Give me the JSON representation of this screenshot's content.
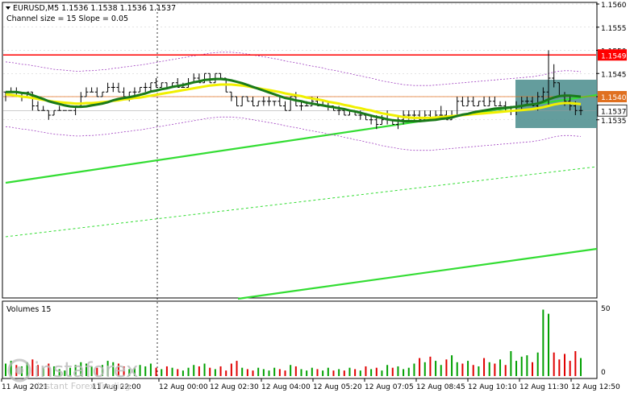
{
  "header": {
    "symbol_line": "EURUSD,M5  1.1536 1.1538 1.1536 1.1537",
    "indicator_line": "Channel size = 15 Slope = 0.05"
  },
  "volume_panel": {
    "title": "Volumes 15",
    "axis_labels": [
      "50",
      "0"
    ]
  },
  "watermark": {
    "brand": "instaforex",
    "tagline": "Instant Forex Trading"
  },
  "colors": {
    "bull_volume": "#00a000",
    "bear_volume": "#e00000",
    "ma_fast": "#1a7a1a",
    "ma_slow": "#f0f000",
    "channel": "#33dd33",
    "resistance": "#ff0000",
    "highlight_box": "#4f8f8f"
  },
  "chart_data": {
    "type": "candlestick",
    "symbol": "EURUSD",
    "timeframe": "M5",
    "ylim": [
      1.153,
      1.156
    ],
    "price_ticks": [
      1.156,
      1.1555,
      1.155,
      1.1545,
      1.154,
      1.1535
    ],
    "price_tick_labels": [
      "1.1560",
      "1.1555",
      "1.1550",
      "1.1545",
      "1.1540",
      "1.1535"
    ],
    "time_labels": [
      "11 Aug 2021",
      "11 Aug 22:00",
      "12 Aug 00:00",
      "12 Aug 02:30",
      "12 Aug 04:00",
      "12 Aug 05:20",
      "12 Aug 07:05",
      "12 Aug 08:45",
      "12 Aug 10:10",
      "12 Aug 11:30",
      "12 Aug 12:50"
    ],
    "levels": [
      {
        "price": 1.1549,
        "label": "1.1549",
        "style": "resistance"
      },
      {
        "price": 1.154,
        "label": "1.1540",
        "style": "support"
      }
    ],
    "current_price": {
      "price": 1.1537,
      "label": "1.1537"
    },
    "candles": [
      [
        1.1541,
        1.1541,
        1.1539,
        1.1541
      ],
      [
        1.1541,
        1.1542,
        1.1541,
        1.1541
      ],
      [
        1.1541,
        1.1542,
        1.154,
        1.154
      ],
      [
        1.154,
        1.1541,
        1.1539,
        1.154
      ],
      [
        1.154,
        1.1541,
        1.154,
        1.1541
      ],
      [
        1.1541,
        1.1541,
        1.1537,
        1.1538
      ],
      [
        1.1538,
        1.1539,
        1.1537,
        1.1537
      ],
      [
        1.1537,
        1.1538,
        1.1537,
        1.1537
      ],
      [
        1.1537,
        1.1537,
        1.1535,
        1.1536
      ],
      [
        1.1536,
        1.1537,
        1.1536,
        1.1537
      ],
      [
        1.1537,
        1.1538,
        1.1537,
        1.1537
      ],
      [
        1.1537,
        1.1537,
        1.1537,
        1.1537
      ],
      [
        1.1537,
        1.1537,
        1.1537,
        1.1537
      ],
      [
        1.1537,
        1.1538,
        1.1536,
        1.1538
      ],
      [
        1.1538,
        1.1541,
        1.1538,
        1.154
      ],
      [
        1.154,
        1.1542,
        1.154,
        1.1541
      ],
      [
        1.1541,
        1.1542,
        1.1541,
        1.1541
      ],
      [
        1.1541,
        1.1542,
        1.154,
        1.154
      ],
      [
        1.154,
        1.1541,
        1.154,
        1.1541
      ],
      [
        1.1541,
        1.1543,
        1.1541,
        1.1542
      ],
      [
        1.1542,
        1.1543,
        1.1541,
        1.1542
      ],
      [
        1.1542,
        1.1543,
        1.1541,
        1.1541
      ],
      [
        1.1541,
        1.1542,
        1.154,
        1.154
      ],
      [
        1.154,
        1.1541,
        1.1539,
        1.1541
      ],
      [
        1.1541,
        1.1542,
        1.154,
        1.1541
      ],
      [
        1.1541,
        1.1542,
        1.1541,
        1.1542
      ],
      [
        1.1542,
        1.1543,
        1.1541,
        1.1542
      ],
      [
        1.1542,
        1.1543,
        1.1541,
        1.1543
      ],
      [
        1.1543,
        1.1544,
        1.1542,
        1.1542
      ],
      [
        1.1542,
        1.1543,
        1.1542,
        1.1543
      ],
      [
        1.1543,
        1.1543,
        1.1542,
        1.1542
      ],
      [
        1.1542,
        1.1543,
        1.1542,
        1.1543
      ],
      [
        1.1543,
        1.1544,
        1.1542,
        1.1542
      ],
      [
        1.1542,
        1.1543,
        1.1542,
        1.1542
      ],
      [
        1.1542,
        1.1544,
        1.1542,
        1.1543
      ],
      [
        1.1543,
        1.1545,
        1.1543,
        1.1544
      ],
      [
        1.1544,
        1.1545,
        1.1543,
        1.1543
      ],
      [
        1.1543,
        1.1545,
        1.1543,
        1.1545
      ],
      [
        1.1545,
        1.1545,
        1.1543,
        1.1543
      ],
      [
        1.1543,
        1.1545,
        1.1543,
        1.1545
      ],
      [
        1.1545,
        1.1545,
        1.1544,
        1.1544
      ],
      [
        1.1544,
        1.1544,
        1.1541,
        1.1541
      ],
      [
        1.1541,
        1.1541,
        1.1539,
        1.154
      ],
      [
        1.154,
        1.154,
        1.1538,
        1.1538
      ],
      [
        1.1538,
        1.154,
        1.1538,
        1.154
      ],
      [
        1.154,
        1.154,
        1.1539,
        1.1539
      ],
      [
        1.1539,
        1.154,
        1.1538,
        1.1538
      ],
      [
        1.1538,
        1.1539,
        1.1538,
        1.1539
      ],
      [
        1.1539,
        1.154,
        1.1538,
        1.1539
      ],
      [
        1.1539,
        1.154,
        1.1538,
        1.1539
      ],
      [
        1.1539,
        1.1539,
        1.1538,
        1.1539
      ],
      [
        1.1539,
        1.154,
        1.1538,
        1.1538
      ],
      [
        1.1538,
        1.1539,
        1.1537,
        1.1537
      ],
      [
        1.1537,
        1.154,
        1.1537,
        1.154
      ],
      [
        1.154,
        1.1541,
        1.1538,
        1.1538
      ],
      [
        1.1538,
        1.1539,
        1.1537,
        1.1538
      ],
      [
        1.1538,
        1.1539,
        1.1538,
        1.1538
      ],
      [
        1.1538,
        1.154,
        1.1538,
        1.1539
      ],
      [
        1.1539,
        1.154,
        1.1538,
        1.1538
      ],
      [
        1.1538,
        1.1539,
        1.1538,
        1.1538
      ],
      [
        1.1538,
        1.1539,
        1.1537,
        1.1538
      ],
      [
        1.1538,
        1.1538,
        1.1537,
        1.1537
      ],
      [
        1.1537,
        1.1538,
        1.1536,
        1.1537
      ],
      [
        1.1537,
        1.1537,
        1.1536,
        1.1536
      ],
      [
        1.1536,
        1.1537,
        1.1536,
        1.1537
      ],
      [
        1.1537,
        1.1537,
        1.1536,
        1.1536
      ],
      [
        1.1536,
        1.1537,
        1.1535,
        1.1536
      ],
      [
        1.1536,
        1.1536,
        1.1535,
        1.1535
      ],
      [
        1.1535,
        1.1536,
        1.1534,
        1.1535
      ],
      [
        1.1535,
        1.1536,
        1.1533,
        1.1534
      ],
      [
        1.1534,
        1.1536,
        1.1534,
        1.1535
      ],
      [
        1.1535,
        1.1537,
        1.1534,
        1.1535
      ],
      [
        1.1535,
        1.1535,
        1.1534,
        1.1534
      ],
      [
        1.1534,
        1.1536,
        1.1533,
        1.1535
      ],
      [
        1.1535,
        1.1537,
        1.1534,
        1.1536
      ],
      [
        1.1536,
        1.1537,
        1.1535,
        1.1536
      ],
      [
        1.1536,
        1.1537,
        1.1535,
        1.1536
      ],
      [
        1.1536,
        1.1537,
        1.1535,
        1.1535
      ],
      [
        1.1535,
        1.1537,
        1.1535,
        1.1536
      ],
      [
        1.1536,
        1.1537,
        1.1535,
        1.1535
      ],
      [
        1.1535,
        1.1537,
        1.1535,
        1.1536
      ],
      [
        1.1536,
        1.1538,
        1.1535,
        1.1536
      ],
      [
        1.1536,
        1.1537,
        1.1535,
        1.1535
      ],
      [
        1.1535,
        1.1537,
        1.1535,
        1.1536
      ],
      [
        1.1536,
        1.154,
        1.1536,
        1.1539
      ],
      [
        1.1539,
        1.154,
        1.1538,
        1.1538
      ],
      [
        1.1538,
        1.154,
        1.1538,
        1.1539
      ],
      [
        1.1539,
        1.154,
        1.1538,
        1.1538
      ],
      [
        1.1538,
        1.1539,
        1.1538,
        1.1539
      ],
      [
        1.1539,
        1.154,
        1.1538,
        1.1538
      ],
      [
        1.1538,
        1.154,
        1.1538,
        1.1539
      ],
      [
        1.1539,
        1.154,
        1.1538,
        1.1538
      ],
      [
        1.1538,
        1.1539,
        1.1538,
        1.1538
      ],
      [
        1.1538,
        1.1539,
        1.1537,
        1.1537
      ],
      [
        1.1537,
        1.1538,
        1.1536,
        1.1537
      ],
      [
        1.1537,
        1.1539,
        1.1536,
        1.1538
      ],
      [
        1.1538,
        1.154,
        1.1537,
        1.1539
      ],
      [
        1.1539,
        1.154,
        1.1538,
        1.1539
      ],
      [
        1.1539,
        1.154,
        1.1538,
        1.1538
      ],
      [
        1.1538,
        1.1541,
        1.1537,
        1.154
      ],
      [
        1.154,
        1.1542,
        1.1539,
        1.1541
      ],
      [
        1.1541,
        1.155,
        1.1538,
        1.1544
      ],
      [
        1.1544,
        1.1547,
        1.1542,
        1.1543
      ],
      [
        1.1543,
        1.1543,
        1.154,
        1.154
      ],
      [
        1.154,
        1.1541,
        1.1538,
        1.1539
      ],
      [
        1.1539,
        1.154,
        1.1537,
        1.1538
      ],
      [
        1.1538,
        1.1539,
        1.1536,
        1.1537
      ],
      [
        1.1537,
        1.1538,
        1.1536,
        1.1537
      ]
    ],
    "volumes": [
      9,
      11,
      8,
      7,
      10,
      12,
      8,
      6,
      9,
      7,
      5,
      4,
      6,
      8,
      10,
      9,
      7,
      6,
      8,
      11,
      10,
      9,
      7,
      5,
      6,
      8,
      7,
      9,
      6,
      5,
      7,
      6,
      5,
      4,
      6,
      8,
      7,
      9,
      6,
      5,
      7,
      4,
      9,
      11,
      6,
      5,
      4,
      6,
      5,
      4,
      6,
      5,
      4,
      8,
      7,
      5,
      4,
      6,
      5,
      4,
      6,
      4,
      5,
      4,
      6,
      5,
      4,
      7,
      5,
      6,
      4,
      8,
      6,
      7,
      5,
      6,
      9,
      13,
      10,
      14,
      11,
      8,
      12,
      15,
      10,
      9,
      11,
      8,
      7,
      13,
      10,
      9,
      12,
      8,
      18,
      11,
      14,
      15,
      10,
      17,
      48,
      45,
      17,
      12,
      16,
      11,
      18,
      13
    ],
    "volume_ylim": [
      0,
      50
    ],
    "series": [
      {
        "name": "ma_fast",
        "values": [
          1.1541,
          1.1541,
          1.1541,
          1.15408,
          1.15407,
          1.15403,
          1.15399,
          1.15395,
          1.1539,
          1.15387,
          1.15384,
          1.15381,
          1.15379,
          1.15378,
          1.15378,
          1.15379,
          1.15381,
          1.15383,
          1.15385,
          1.15388,
          1.15392,
          1.15395,
          1.15397,
          1.15399,
          1.15401,
          1.15404,
          1.15407,
          1.15411,
          1.15413,
          1.15416,
          1.15418,
          1.15421,
          1.15423,
          1.15425,
          1.15428,
          1.15431,
          1.15433,
          1.15436,
          1.15437,
          1.15438,
          1.15438,
          1.15437,
          1.15435,
          1.15432,
          1.15429,
          1.15425,
          1.15421,
          1.15417,
          1.15413,
          1.15409,
          1.15405,
          1.15401,
          1.15397,
          1.15395,
          1.15392,
          1.1539,
          1.15387,
          1.15385,
          1.15383,
          1.15381,
          1.15379,
          1.15377,
          1.15375,
          1.15373,
          1.1537,
          1.15368,
          1.15365,
          1.15362,
          1.15359,
          1.15356,
          1.15354,
          1.15351,
          1.15349,
          1.15348,
          1.15347,
          1.15347,
          1.15347,
          1.15347,
          1.15348,
          1.15349,
          1.1535,
          1.15352,
          1.15353,
          1.15355,
          1.15358,
          1.15361,
          1.15363,
          1.15366,
          1.15368,
          1.1537,
          1.15372,
          1.15374,
          1.15375,
          1.15376,
          1.15377,
          1.15378,
          1.1538,
          1.15382,
          1.15383,
          1.15385,
          1.15389,
          1.15394,
          1.15398,
          1.15401,
          1.15402,
          1.15402,
          1.15401,
          1.154
        ]
      },
      {
        "name": "ma_slow",
        "values": [
          1.15405,
          1.15404,
          1.15402,
          1.154,
          1.15399,
          1.15397,
          1.15395,
          1.15393,
          1.15391,
          1.15389,
          1.15388,
          1.15387,
          1.15386,
          1.15385,
          1.15385,
          1.15386,
          1.15386,
          1.15387,
          1.15388,
          1.15389,
          1.15391,
          1.15392,
          1.15394,
          1.15395,
          1.15397,
          1.15398,
          1.154,
          1.15402,
          1.15404,
          1.15406,
          1.15408,
          1.1541,
          1.15412,
          1.15414,
          1.15416,
          1.15418,
          1.1542,
          1.15422,
          1.15424,
          1.15425,
          1.15426,
          1.15426,
          1.15426,
          1.15425,
          1.15424,
          1.15422,
          1.1542,
          1.15418,
          1.15416,
          1.15414,
          1.15412,
          1.1541,
          1.15407,
          1.15405,
          1.15403,
          1.15401,
          1.15398,
          1.15396,
          1.15394,
          1.15392,
          1.15389,
          1.15387,
          1.15385,
          1.15382,
          1.1538,
          1.15377,
          1.15375,
          1.15372,
          1.1537,
          1.15367,
          1.15364,
          1.15362,
          1.1536,
          1.15358,
          1.15356,
          1.15355,
          1.15354,
          1.15354,
          1.15354,
          1.15354,
          1.15355,
          1.15356,
          1.15357,
          1.15358,
          1.15359,
          1.1536,
          1.15361,
          1.15362,
          1.15363,
          1.15364,
          1.15365,
          1.15366,
          1.15367,
          1.15368,
          1.15369,
          1.1537,
          1.15371,
          1.15372,
          1.15373,
          1.15375,
          1.15377,
          1.1538,
          1.15383,
          1.15385,
          1.15386,
          1.15386,
          1.15385,
          1.15384
        ]
      }
    ]
  }
}
